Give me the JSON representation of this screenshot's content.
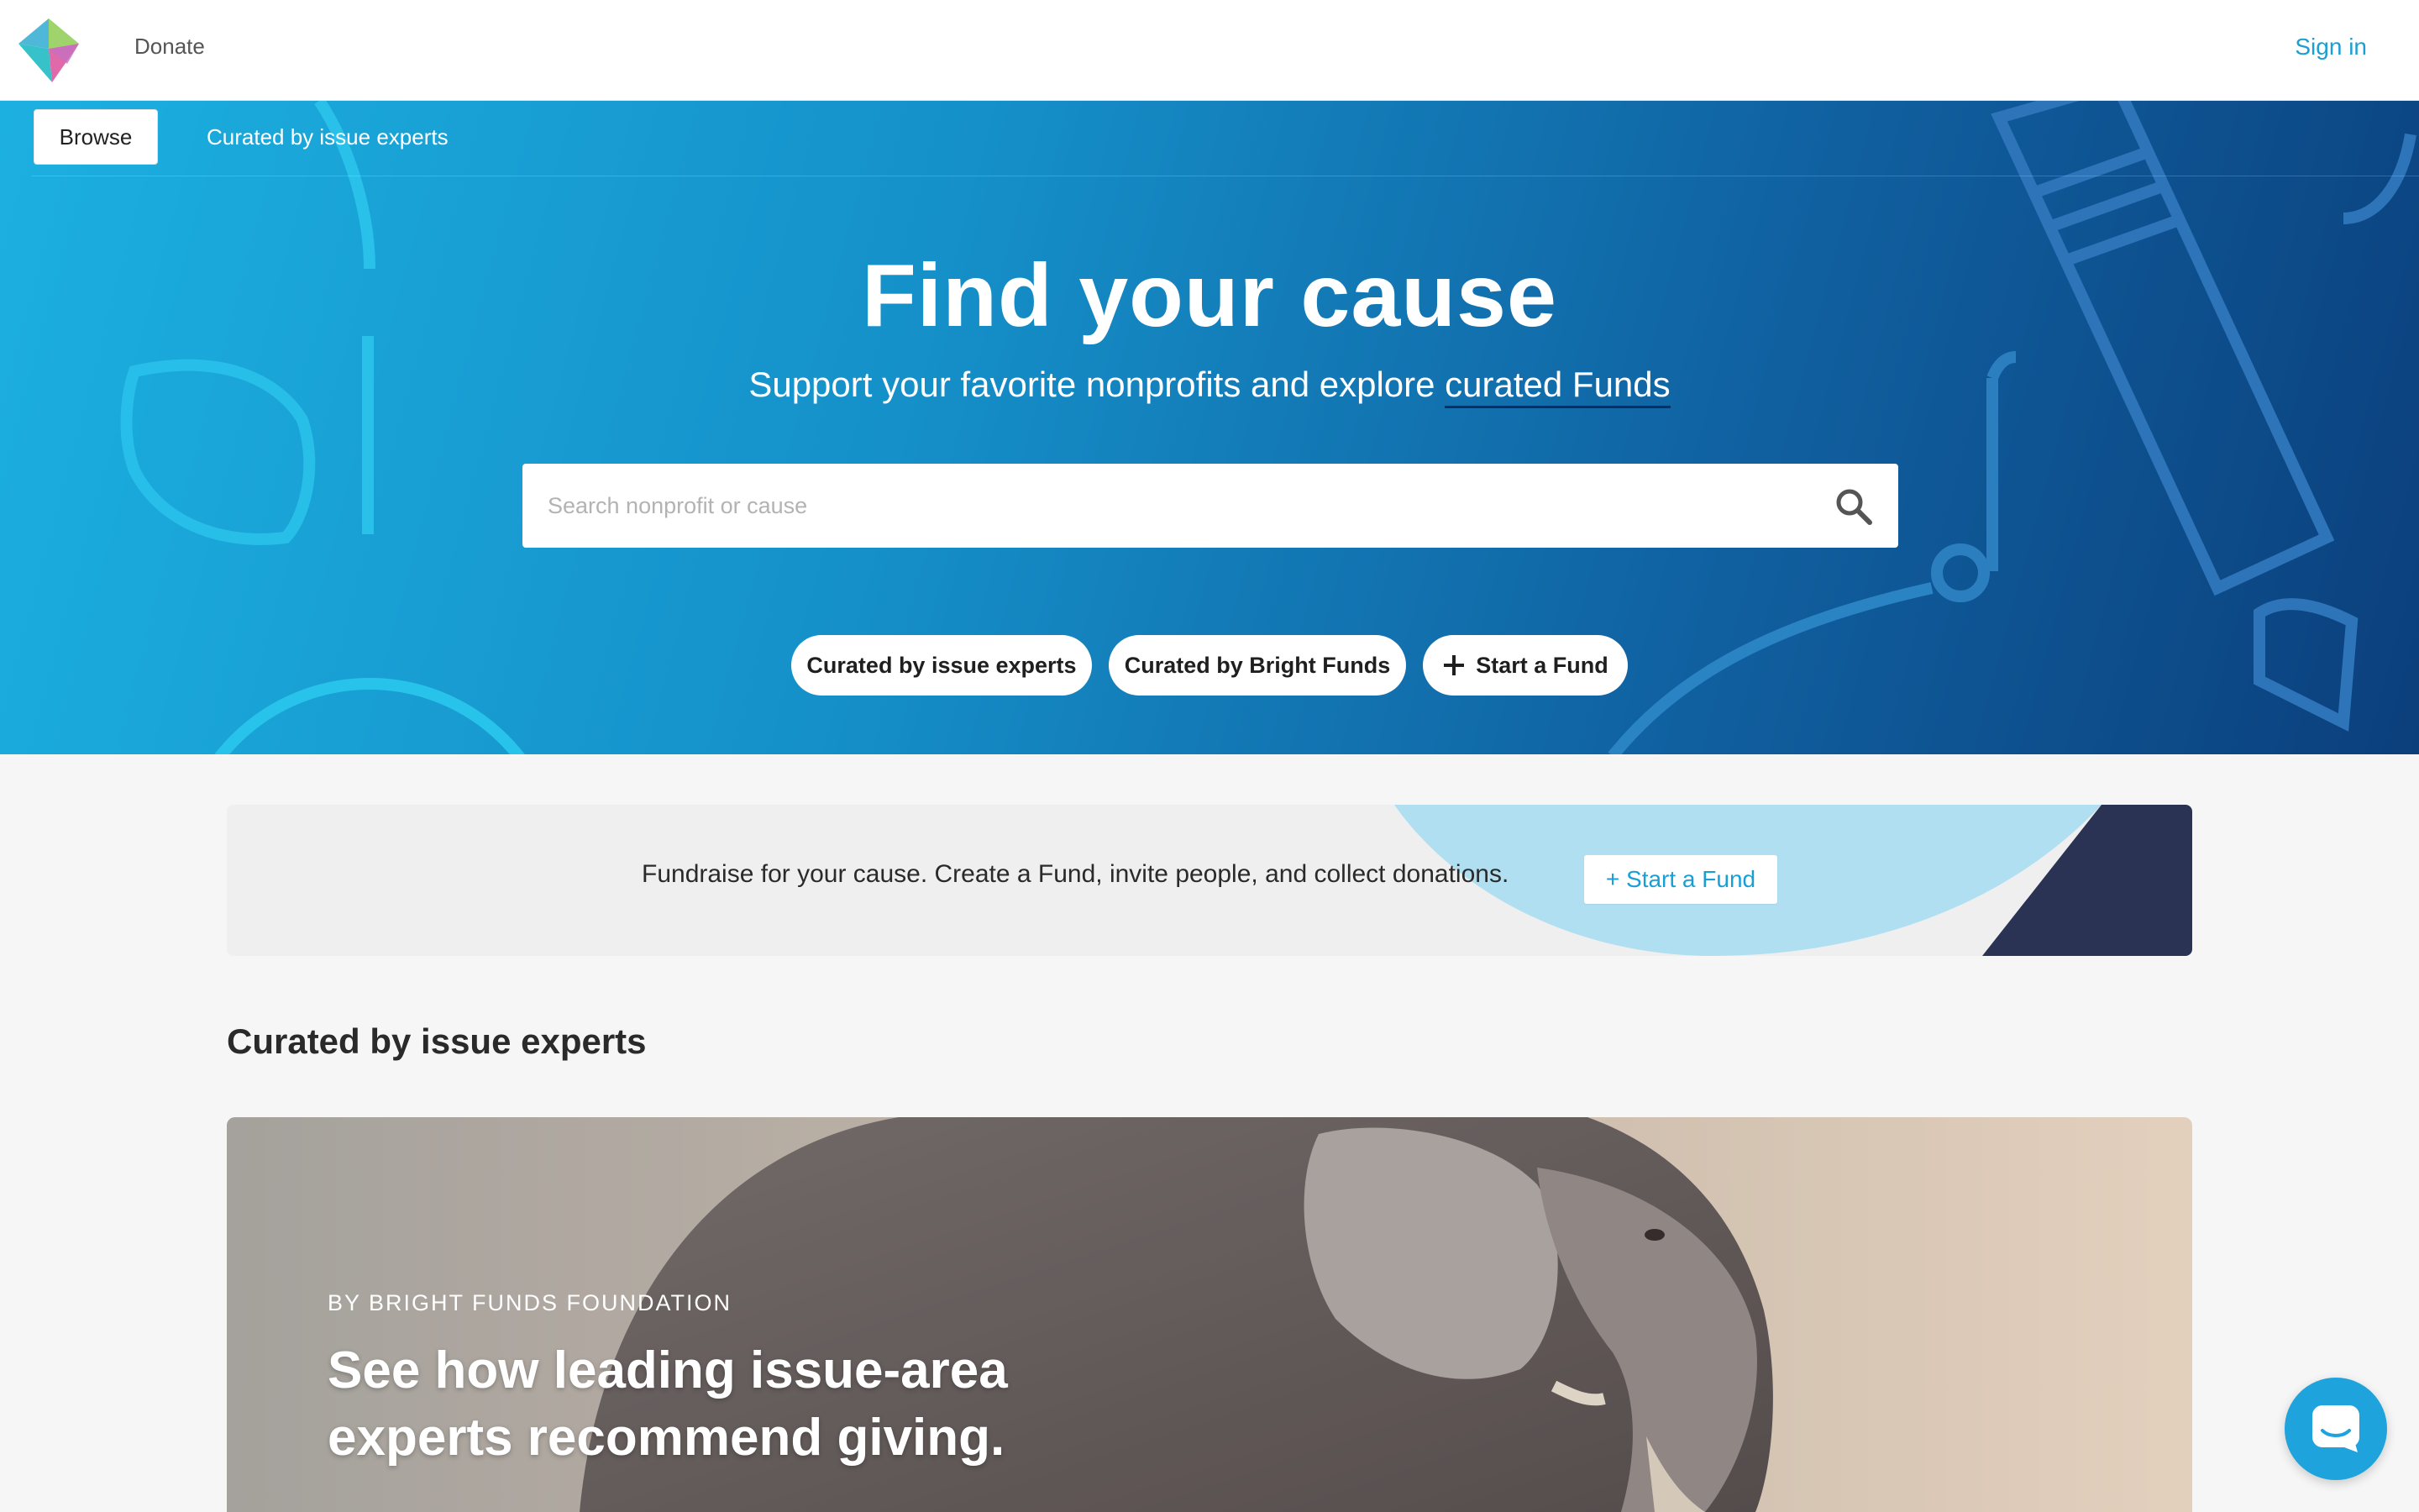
{
  "topbar": {
    "donate": "Donate",
    "sign_in": "Sign in"
  },
  "subnav": {
    "browse": "Browse",
    "curated": "Curated by issue experts"
  },
  "hero": {
    "title": "Find your cause",
    "subtitle_prefix": "Support your favorite nonprofits and explore ",
    "subtitle_link": "curated Funds",
    "search_placeholder": "Search nonprofit or cause"
  },
  "pills": {
    "issue_experts": "Curated by issue experts",
    "bright_funds": "Curated by Bright Funds",
    "start_fund": "Start a Fund"
  },
  "banner": {
    "text": "Fundraise for your cause. Create a Fund, invite people, and collect donations.",
    "button": "+ Start a Fund"
  },
  "section": {
    "title": "Curated by issue experts"
  },
  "feature": {
    "eyebrow": "BY BRIGHT FUNDS FOUNDATION",
    "heading": "See how leading issue-area experts recommend giving."
  },
  "colors": {
    "accent": "#1a9fd4",
    "hero_start": "#1cb0e0",
    "hero_end": "#0b3f7c",
    "banner_navy": "#2b3354",
    "banner_light_blue": "#b0dff2"
  },
  "icons": [
    "bright-funds-logo-icon",
    "search-icon",
    "plus-icon",
    "chat-icon"
  ]
}
